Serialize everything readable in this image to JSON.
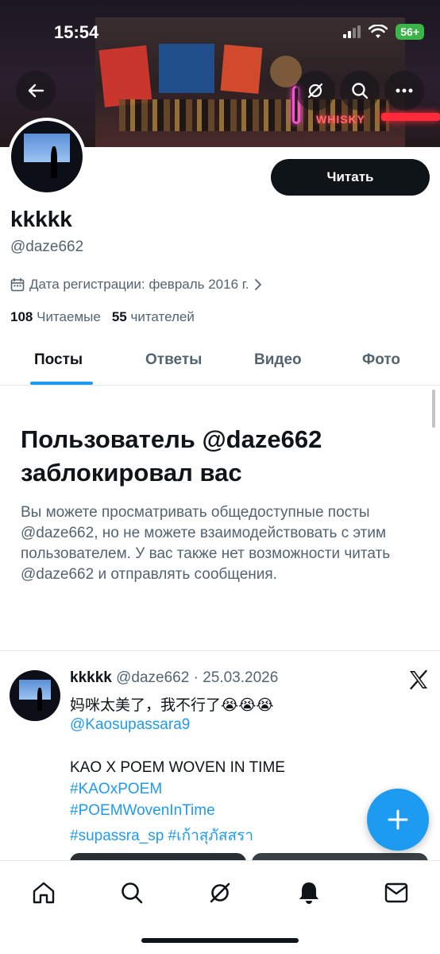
{
  "status_bar": {
    "time": "15:54",
    "battery": "56+"
  },
  "banner": {
    "neon_sign": "WHISKY"
  },
  "profile": {
    "follow_button": "Читать",
    "display_name": "kkkkk",
    "handle": "@daze662",
    "join_date": "Дата регистрации: февраль 2016 г.",
    "following_count": "108",
    "following_label": "Читаемые",
    "followers_count": "55",
    "followers_label": "читателей"
  },
  "tabs": [
    {
      "label": "Посты",
      "active": true
    },
    {
      "label": "Ответы",
      "active": false
    },
    {
      "label": "Видео",
      "active": false
    },
    {
      "label": "Фото",
      "active": false
    }
  ],
  "blocked": {
    "title": "Пользователь @daze662 заблокировал вас",
    "description": "Вы можете просматривать общедоступные посты @daze662, но не можете взаимодействовать с этим пользователем. У вас также нет возможности читать @daze662 и отправлять сообщения."
  },
  "post": {
    "name": "kkkkk",
    "meta": "@daze662 · 25.03.2026",
    "text_line1": "妈咪太美了，我不行了😭😭😭",
    "mention": "@Kaosupassara9",
    "text_line3": "KAO X POEM WOVEN IN TIME",
    "hashtag1": "#KAOxPOEM",
    "hashtag2": "#POEMWovenInTime",
    "hashtag3": "#supassra_sp #เก้าสุภัสสรา"
  },
  "colors": {
    "accent": "#1d9bf0",
    "text": "#0f1419",
    "secondary": "#536471"
  },
  "bottom_nav": [
    "home-icon",
    "search-icon",
    "grok-icon",
    "notifications-icon",
    "messages-icon"
  ]
}
